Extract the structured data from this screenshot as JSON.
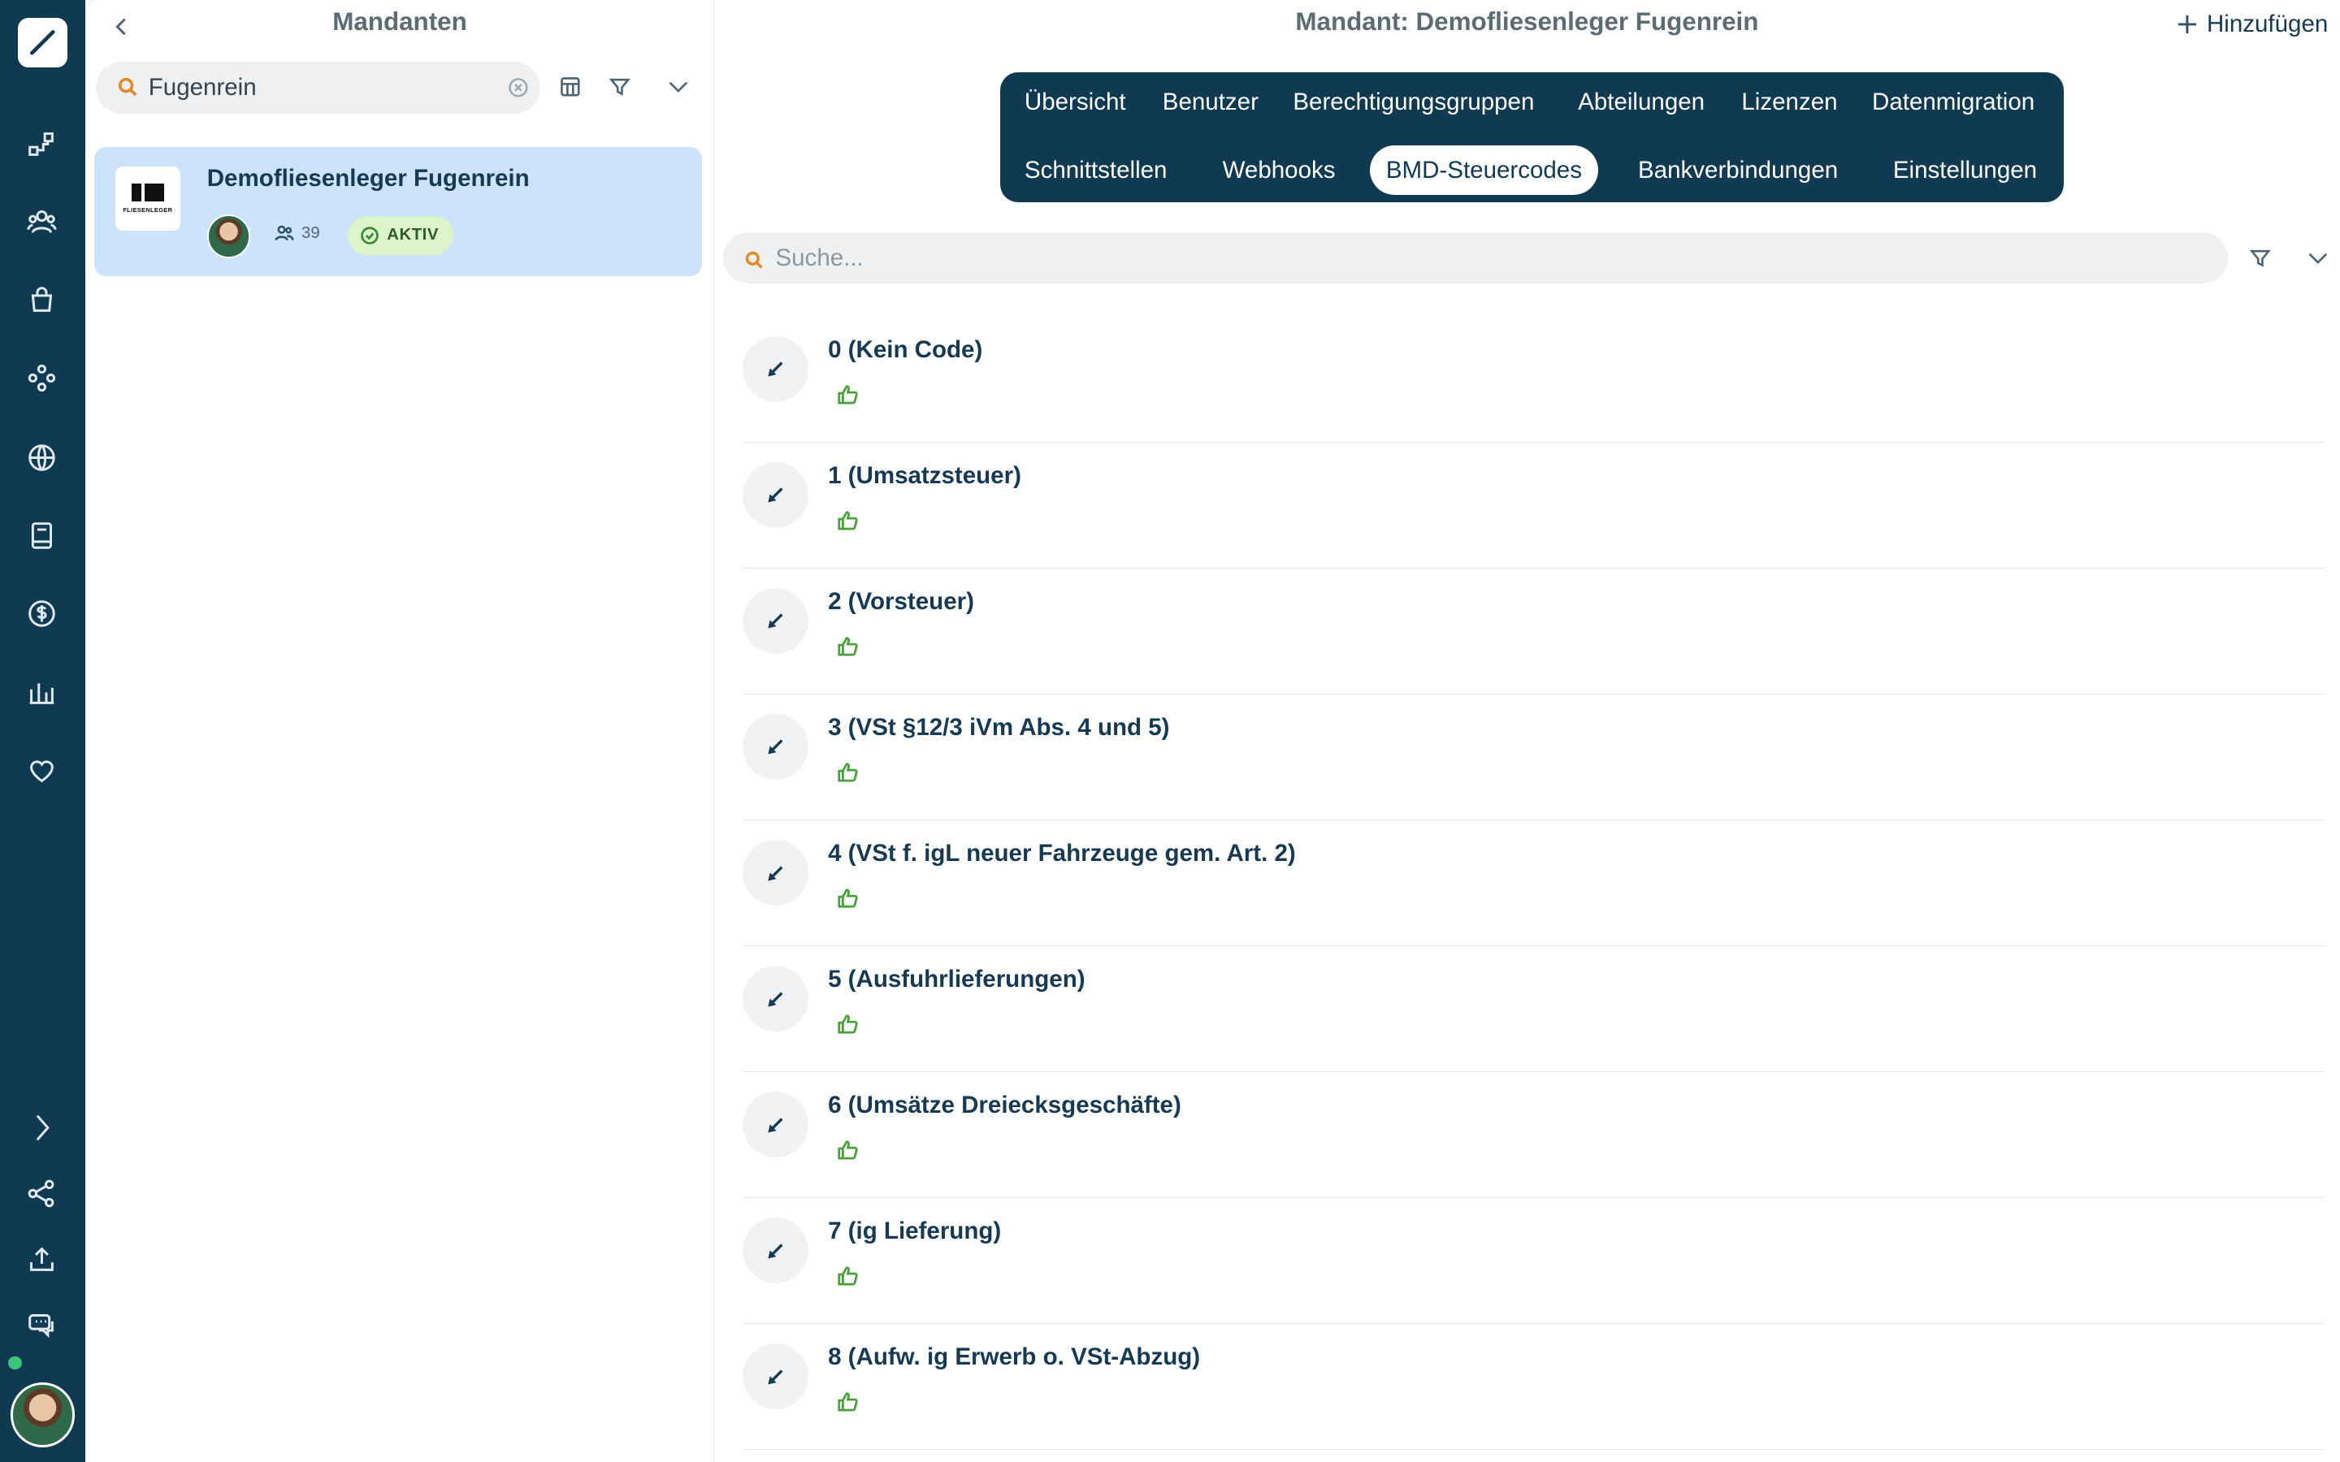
{
  "left_panel": {
    "title": "Mandanten",
    "search_value": "Fugenrein",
    "card": {
      "name": "Demofliesenleger Fugenrein",
      "logo_text": "FLIESENLEGER",
      "user_count": "39",
      "status": "AKTIV"
    }
  },
  "main": {
    "title": "Mandant: Demofliesenleger Fugenrein",
    "add_label": "Hinzufügen",
    "tabs": [
      "Übersicht",
      "Benutzer",
      "Berechtigungsgruppen",
      "Abteilungen",
      "Lizenzen",
      "Datenmigration",
      "Schnittstellen",
      "Webhooks",
      "BMD-Steuercodes",
      "Bankverbindungen",
      "Einstellungen"
    ],
    "active_tab": "BMD-Steuercodes",
    "search_placeholder": "Suche...",
    "items": [
      "0 (Kein Code)",
      "1 (Umsatzsteuer)",
      "2 (Vorsteuer)",
      "3 (VSt §12/3 iVm Abs. 4 und 5)",
      "4 (VSt f. igL neuer Fahrzeuge gem. Art. 2)",
      "5 (Ausfuhrlieferungen)",
      "6 (Umsätze Dreiecksgeschäfte)",
      "7 (ig Lieferung)",
      "8 (Aufw. ig Erwerb o. VSt-Abzug)"
    ]
  },
  "colors": {
    "rail": "#0f3a52",
    "accent_orange": "#e08a2b",
    "card_selected": "#cde3fb",
    "status_badge": "#ddf3c9",
    "thumb_green": "#4aa03a"
  },
  "icons": {
    "rail": [
      "brush-logo-icon",
      "workflow-icon",
      "users-icon",
      "shopping-bag-icon",
      "modules-icon",
      "globe-icon",
      "book-icon",
      "dollar-icon",
      "bar-chart-icon",
      "heart-icon",
      "chevron-right-icon",
      "share-icon",
      "upload-icon",
      "chat-icon"
    ]
  }
}
